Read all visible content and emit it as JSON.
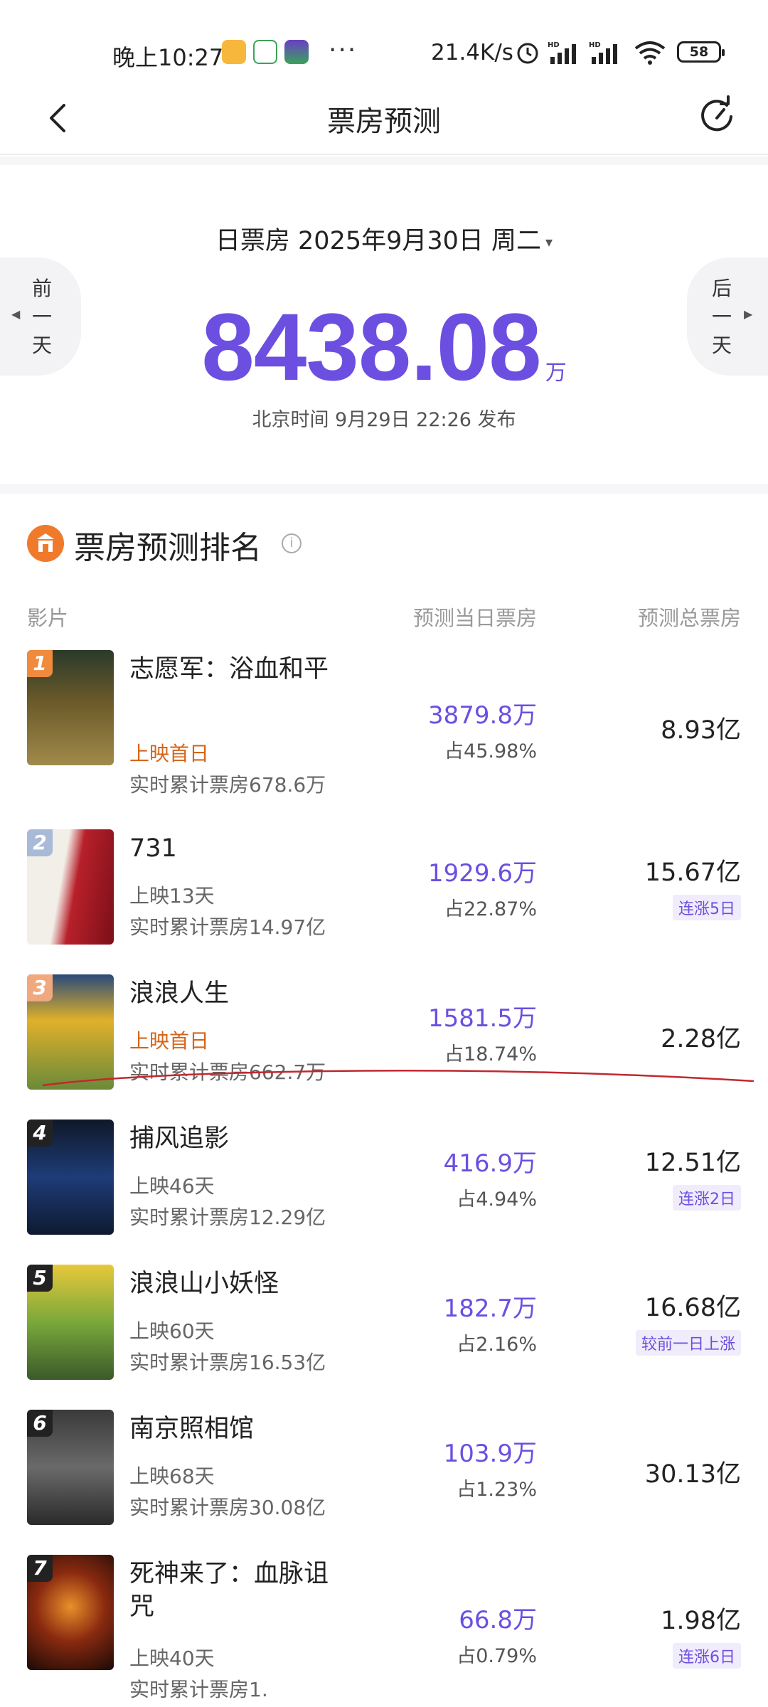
{
  "status_bar": {
    "time": "晚上10:27",
    "dots": "···",
    "speed": "21.4K/s",
    "battery": "58"
  },
  "nav": {
    "title": "票房预测"
  },
  "summary": {
    "date_label": "日票房 2025年9月30日 周二",
    "caret": "▾",
    "value": "8438.08",
    "unit": "万",
    "publish_text": "北京时间 9月29日 22:26 发布",
    "prev_label": "前一天",
    "next_label": "后一天"
  },
  "ranking": {
    "title": "票房预测排名",
    "info": "i",
    "col_film": "影片",
    "col_day": "预测当日票房",
    "col_total": "预测总票房",
    "movies": [
      {
        "rank": "1",
        "title": "志愿军：浴血和平",
        "status": "上映首日",
        "cum": "实时累计票房678.6万",
        "day": "3879.8万",
        "share": "占45.98%",
        "total": "8.93亿",
        "tag": ""
      },
      {
        "rank": "2",
        "title": "731",
        "status": "上映13天",
        "cum": "实时累计票房14.97亿",
        "day": "1929.6万",
        "share": "占22.87%",
        "total": "15.67亿",
        "tag": "连涨5日"
      },
      {
        "rank": "3",
        "title": "浪浪人生",
        "status": "上映首日",
        "cum": "实时累计票房662.7万",
        "day": "1581.5万",
        "share": "占18.74%",
        "total": "2.28亿",
        "tag": ""
      },
      {
        "rank": "4",
        "title": "捕风追影",
        "status": "上映46天",
        "cum": "实时累计票房12.29亿",
        "day": "416.9万",
        "share": "占4.94%",
        "total": "12.51亿",
        "tag": "连涨2日"
      },
      {
        "rank": "5",
        "title": "浪浪山小妖怪",
        "status": "上映60天",
        "cum": "实时累计票房16.53亿",
        "day": "182.7万",
        "share": "占2.16%",
        "total": "16.68亿",
        "tag": "较前一日上涨"
      },
      {
        "rank": "6",
        "title": "南京照相馆",
        "status": "上映68天",
        "cum": "实时累计票房30.08亿",
        "day": "103.9万",
        "share": "占1.23%",
        "total": "30.13亿",
        "tag": ""
      },
      {
        "rank": "7",
        "title": "死神来了：血脉诅咒",
        "status": "上映40天",
        "cum": "实时累计票房1.",
        "day": "66.8万",
        "share": "占0.79%",
        "total": "1.98亿",
        "tag": "连涨6日"
      }
    ]
  },
  "colors": {
    "accent": "#6c4fe0",
    "new_release": "#d4651a",
    "rank_gold": "#f08a3c",
    "rank_silver": "#a9b9d8",
    "rank_bronze": "#f0a87e",
    "rank_other": "#222222"
  },
  "icons": [
    "back-arrow-icon",
    "refresh-icon",
    "info-icon",
    "wifi-icon",
    "signal-icon",
    "alarm-icon"
  ]
}
